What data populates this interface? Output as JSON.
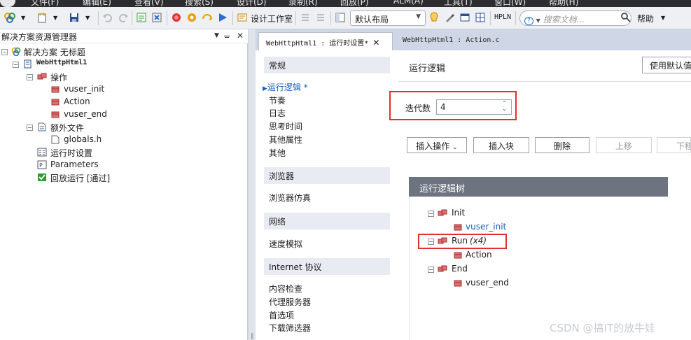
{
  "menubar": {
    "items": [
      "文件(F)",
      "编辑(E)",
      "查看(V)",
      "搜索(S)",
      "设计(D)",
      "录制(R)",
      "回放(P)",
      "ALM(A)",
      "工具(T)",
      "窗口(W)",
      "帮助(H)"
    ]
  },
  "toolbar": {
    "design_studio": "设计工作室",
    "layout_combo": "默认布局",
    "hpln": "HPLN",
    "search_placeholder": "搜索文档...",
    "help": "帮助"
  },
  "explorer": {
    "title": "解决方案资源管理器",
    "solution": "解决方案 无标题",
    "script": "WebHttpHtml1",
    "actions_folder": "操作",
    "actions": [
      "vuser_init",
      "Action",
      "vuser_end"
    ],
    "extra_files": "额外文件",
    "extra_items": [
      "globals.h"
    ],
    "runtime_settings": "运行时设置",
    "parameters": "Parameters",
    "replay": "回放运行 [通过]"
  },
  "tabs": {
    "active": "WebHttpHtml1 : 运行时设置*",
    "second": "WebHttpHtml1 : Action.c"
  },
  "settings": {
    "categories": [
      {
        "header": "常规",
        "items": [
          "运行逻辑 *",
          "节奏",
          "日志",
          "思考时间",
          "其他属性",
          "其他"
        ]
      },
      {
        "header": "浏览器",
        "items": [
          "浏览器仿真"
        ]
      },
      {
        "header": "网络",
        "items": [
          "速度模拟"
        ]
      },
      {
        "header": "Internet 协议",
        "items": [
          "内容检查",
          "代理服务器",
          "首选项",
          "下载筛选器"
        ]
      }
    ],
    "selected_item": "运行逻辑 *"
  },
  "run_logic": {
    "title": "运行逻辑",
    "use_default_btn": "使用默认值",
    "iteration_label": "迭代数",
    "iteration_value": "4",
    "buttons": {
      "insert_action": "插入操作",
      "insert_block": "插入块",
      "delete": "删除",
      "move_up": "上移",
      "move_down": "下移"
    },
    "tree_title": "运行逻辑树",
    "tree": {
      "init": "Init",
      "init_child": "vuser_init",
      "run": "Run",
      "run_suffix": "(x4)",
      "run_child": "Action",
      "end": "End",
      "end_child": "vuser_end"
    }
  },
  "watermark": "CSDN @搞IT的放牛娃",
  "colors": {
    "accent_blue": "#1a5fb4",
    "highlight_red": "#e03030",
    "tree_header": "#6d7480"
  }
}
